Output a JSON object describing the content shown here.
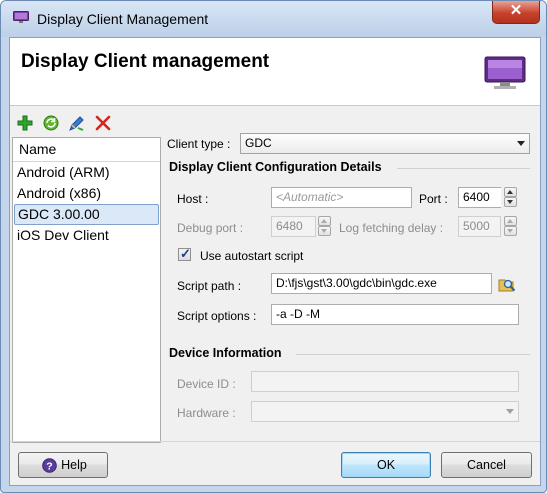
{
  "window": {
    "title": "Display Client Management",
    "close_label": "✕"
  },
  "banner": {
    "title": "Display Client management"
  },
  "list": {
    "header": "Name",
    "items": [
      {
        "label": "Android (ARM)",
        "selected": false
      },
      {
        "label": "Android (x86)",
        "selected": false
      },
      {
        "label": "GDC 3.00.00",
        "selected": true
      },
      {
        "label": "iOS Dev Client",
        "selected": false
      }
    ]
  },
  "form": {
    "client_type_label": "Client type :",
    "client_type_value": "GDC",
    "config_section": "Display Client Configuration Details",
    "host_label": "Host :",
    "host_placeholder": "<Automatic>",
    "port_label": "Port :",
    "port_value": "6400",
    "debug_port_label": "Debug port :",
    "debug_port_value": "6480",
    "log_delay_label": "Log fetching delay :",
    "log_delay_value": "5000",
    "autostart_label": "Use autostart script",
    "autostart_checked": true,
    "script_path_label": "Script path :",
    "script_path_value": "D:\\fjs\\gst\\3.00\\gdc\\bin\\gdc.exe",
    "script_options_label": "Script options :",
    "script_options_value": "-a -D -M",
    "device_section": "Device Information",
    "device_id_label": "Device ID :",
    "device_id_value": "",
    "hardware_label": "Hardware :",
    "hardware_value": ""
  },
  "buttons": {
    "help": "Help",
    "ok": "OK",
    "cancel": "Cancel"
  },
  "toolbar": {
    "icons": [
      "add-icon",
      "refresh-icon",
      "edit-icon",
      "delete-icon"
    ]
  },
  "colors": {
    "accent": "#3c7fb1",
    "selection": "#dbe8f8",
    "title_bar": "#c3d6ec"
  }
}
